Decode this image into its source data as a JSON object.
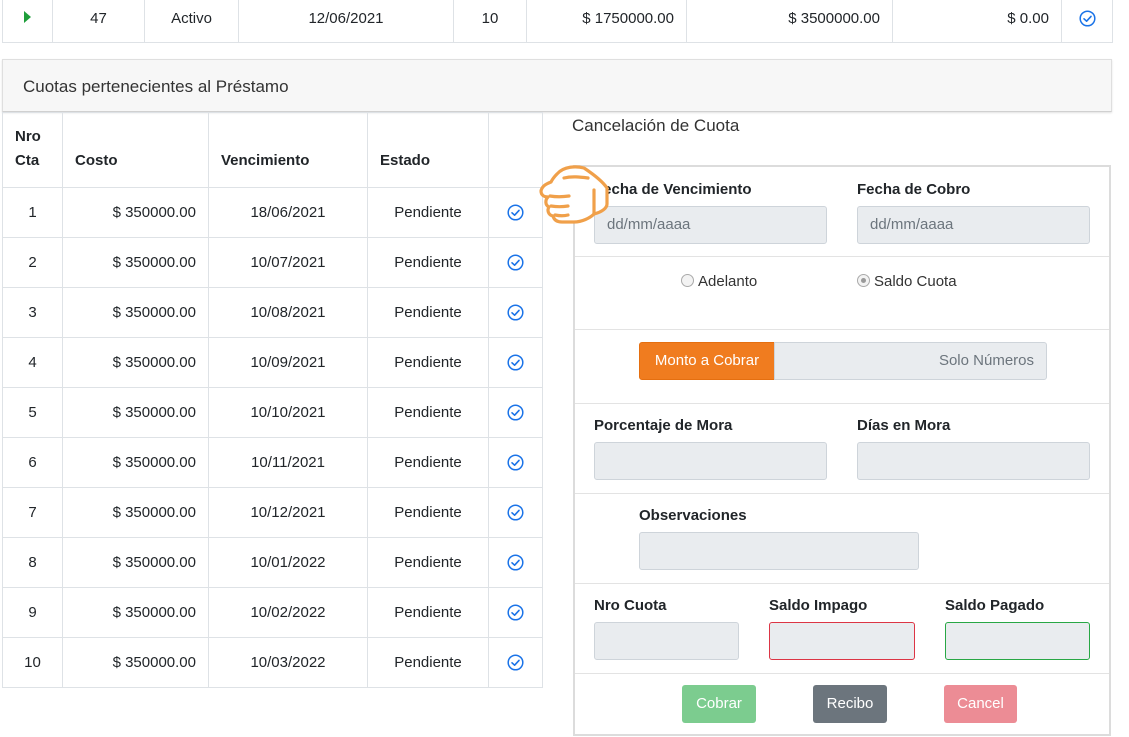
{
  "loan_row": {
    "id": "47",
    "estado": "Activo",
    "fecha": "12/06/2021",
    "cuotas": "10",
    "monto": "$ 1750000.00",
    "total": "$ 3500000.00",
    "saldo": "$ 0.00"
  },
  "cuotas_panel": {
    "title": "Cuotas pertenecientes al Préstamo",
    "headers": [
      "Nro Cta",
      "Costo",
      "Vencimiento",
      "Estado",
      ""
    ],
    "rows": [
      {
        "nro": "1",
        "costo": "$ 350000.00",
        "venc": "18/06/2021",
        "estado": "Pendiente"
      },
      {
        "nro": "2",
        "costo": "$ 350000.00",
        "venc": "10/07/2021",
        "estado": "Pendiente"
      },
      {
        "nro": "3",
        "costo": "$ 350000.00",
        "venc": "10/08/2021",
        "estado": "Pendiente"
      },
      {
        "nro": "4",
        "costo": "$ 350000.00",
        "venc": "10/09/2021",
        "estado": "Pendiente"
      },
      {
        "nro": "5",
        "costo": "$ 350000.00",
        "venc": "10/10/2021",
        "estado": "Pendiente"
      },
      {
        "nro": "6",
        "costo": "$ 350000.00",
        "venc": "10/11/2021",
        "estado": "Pendiente"
      },
      {
        "nro": "7",
        "costo": "$ 350000.00",
        "venc": "10/12/2021",
        "estado": "Pendiente"
      },
      {
        "nro": "8",
        "costo": "$ 350000.00",
        "venc": "10/01/2022",
        "estado": "Pendiente"
      },
      {
        "nro": "9",
        "costo": "$ 350000.00",
        "venc": "10/02/2022",
        "estado": "Pendiente"
      },
      {
        "nro": "10",
        "costo": "$ 350000.00",
        "venc": "10/03/2022",
        "estado": "Pendiente"
      }
    ]
  },
  "cancelacion": {
    "title": "Cancelación de Cuota",
    "fecha_vencimiento_label": "Fecha de Vencimiento",
    "fecha_vencimiento_placeholder": "dd/mm/aaaa",
    "fecha_cobro_label": "Fecha de Cobro",
    "fecha_cobro_placeholder": "dd/mm/aaaa",
    "radio_adelanto": "Adelanto",
    "radio_saldo": "Saldo Cuota",
    "monto_label": "Monto a Cobrar",
    "monto_placeholder": "Solo Números",
    "porcentaje_mora_label": "Porcentaje de Mora",
    "dias_mora_label": "Días en Mora",
    "observaciones_label": "Observaciones",
    "nro_cuota_label": "Nro Cuota",
    "saldo_impago_label": "Saldo Impago",
    "saldo_pagado_label": "Saldo Pagado",
    "btn_cobrar": "Cobrar",
    "btn_recibo": "Recibo",
    "btn_cancel": "Cancel"
  },
  "colors": {
    "accent_orange": "#f07c1f",
    "success": "#5cb85c",
    "danger": "#dc3545",
    "check_blue": "#1a73e8"
  }
}
